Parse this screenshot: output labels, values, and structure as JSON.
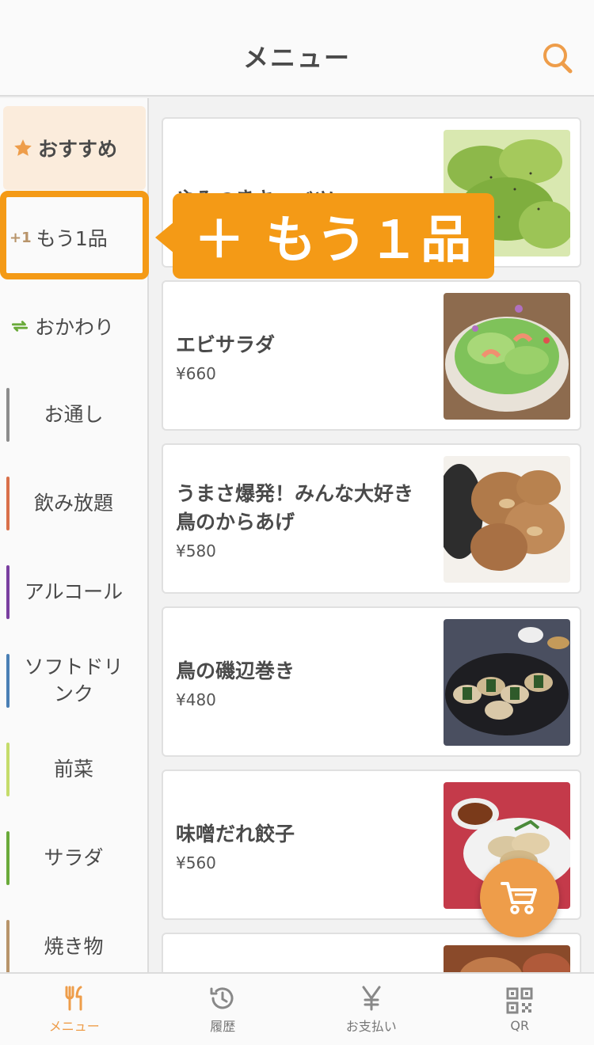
{
  "header": {
    "title": "メニュー"
  },
  "sidebar": {
    "items": [
      {
        "label": "おすすめ",
        "icon": "star-icon"
      },
      {
        "label": "もう1品",
        "icon": "plus-one-icon",
        "icon_text": "+1"
      },
      {
        "label": "おかわり",
        "icon": "refresh-icon"
      },
      {
        "label": "お通し",
        "bar_color": "#8c8c8c"
      },
      {
        "label": "飲み放題",
        "bar_color": "#d9704a"
      },
      {
        "label": "アルコール",
        "bar_color": "#7a3fa0"
      },
      {
        "label": "ソフトドリンク",
        "bar_color": "#4a7fb5"
      },
      {
        "label": "前菜",
        "bar_color": "#c5dc6a"
      },
      {
        "label": "サラダ",
        "bar_color": "#6aaa3a"
      },
      {
        "label": "焼き物",
        "bar_color": "#b8946a"
      }
    ]
  },
  "tooltip": {
    "text": "＋ もう１品"
  },
  "menu": {
    "items": [
      {
        "name": "やみつきキャベツ",
        "price": ""
      },
      {
        "name": "エビサラダ",
        "price": "¥660"
      },
      {
        "name": "うまさ爆発！みんな大好き鳥のからあげ",
        "price": "¥580"
      },
      {
        "name": "鳥の磯辺巻き",
        "price": "¥480"
      },
      {
        "name": "味噌だれ餃子",
        "price": "¥560"
      }
    ]
  },
  "bottom_nav": [
    {
      "label": "メニュー",
      "icon": "fork-knife-icon"
    },
    {
      "label": "履歴",
      "icon": "history-icon"
    },
    {
      "label": "お支払い",
      "icon": "yen-icon"
    },
    {
      "label": "QR",
      "icon": "qr-code-icon"
    }
  ],
  "colors": {
    "accent": "#f49a16",
    "cart": "#ee9d4a"
  }
}
